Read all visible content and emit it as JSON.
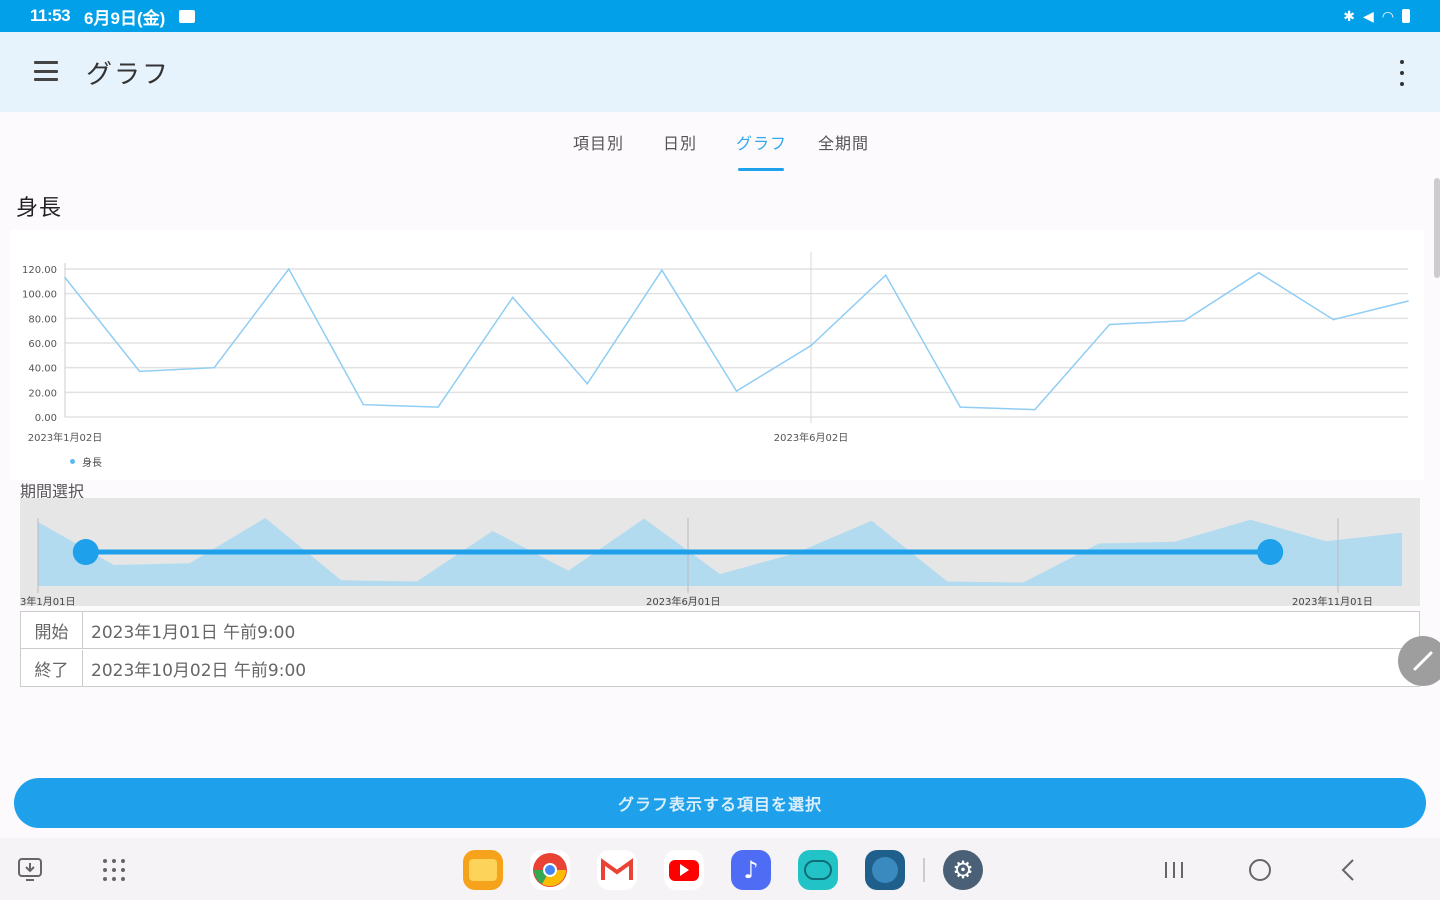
{
  "status_bar": {
    "time": "11:53",
    "date": "6月9日(金)"
  },
  "app_bar": {
    "title": "グラフ"
  },
  "tabs": [
    {
      "label": "項目別",
      "active": false
    },
    {
      "label": "日別",
      "active": false
    },
    {
      "label": "グラフ",
      "active": true
    },
    {
      "label": "全期間",
      "active": false
    }
  ],
  "section_title": "身長",
  "chart_data": {
    "type": "line",
    "title": "",
    "series": [
      {
        "name": "身長",
        "values": [
          113,
          37,
          40,
          120,
          10,
          8,
          97,
          27,
          119,
          21,
          58,
          115,
          8,
          6,
          75,
          78,
          117,
          79,
          94
        ]
      }
    ],
    "ylim": [
      0,
      120
    ],
    "yticks": [
      "0.00",
      "20.00",
      "40.00",
      "60.00",
      "80.00",
      "100.00",
      "120.00"
    ],
    "x_tick_labels": [
      "2023年1月02日",
      "2023年6月02日"
    ],
    "legend": "bottom-left",
    "grid": true,
    "line_color": "#90cdf4"
  },
  "range_selector": {
    "title": "期間選択",
    "tick_labels": [
      "3年1月01日",
      "2023年6月01日",
      "2023年11月01日"
    ],
    "fill_color": "#a8d8f0",
    "handle_color": "#1ea0ea",
    "start_fraction": 0.047,
    "end_fraction": 0.893
  },
  "period": {
    "start_label": "開始",
    "start_value": "2023年1月01日 午前9:00",
    "end_label": "終了",
    "end_value": "2023年10月02日 午前9:00"
  },
  "select_button_label": "グラフ表示する項目を選択",
  "dock_apps": [
    "folder-icon",
    "chrome-icon",
    "gmail-icon",
    "youtube-icon",
    "music-icon",
    "chat-icon",
    "video-icon",
    "settings-icon"
  ]
}
